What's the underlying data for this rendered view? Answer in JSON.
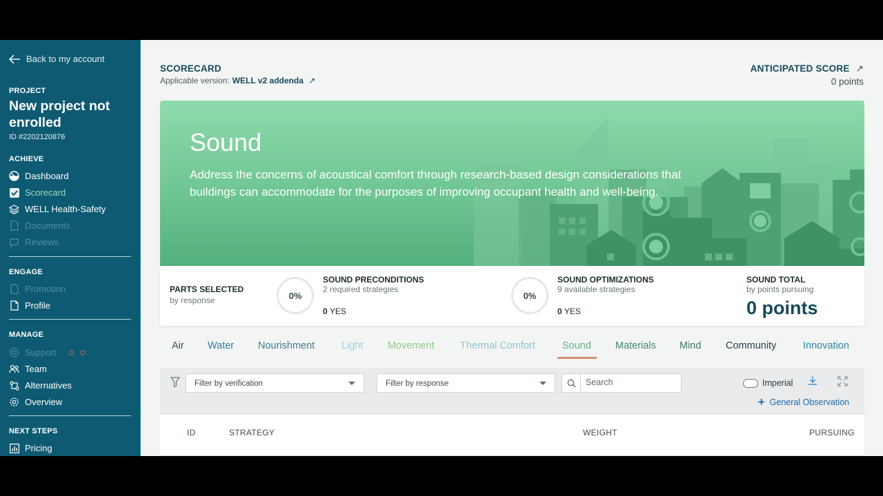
{
  "sidebar": {
    "back_label": "Back to my account",
    "project_section": "PROJECT",
    "project_name": "New project not enrolled",
    "project_id": "ID #2202120876",
    "achieve": {
      "heading": "ACHIEVE",
      "items": [
        {
          "label": "Dashboard",
          "icon": "dashboard-gauge-icon"
        },
        {
          "label": "Scorecard",
          "icon": "checkbox-checked-icon"
        },
        {
          "label": "WELL Health-Safety",
          "icon": "layers-icon"
        },
        {
          "label": "Documents",
          "icon": "document-icon"
        },
        {
          "label": "Reviews",
          "icon": "reviews-icon"
        }
      ]
    },
    "engage": {
      "heading": "ENGAGE",
      "items": [
        {
          "label": "Promotion",
          "icon": "promotion-icon"
        },
        {
          "label": "Profile",
          "icon": "document-icon"
        }
      ]
    },
    "manage": {
      "heading": "MANAGE",
      "items": [
        {
          "label": "Support",
          "icon": "lifebuoy-icon"
        },
        {
          "label": "Team",
          "icon": "team-icon"
        },
        {
          "label": "Alternatives",
          "icon": "alternatives-icon"
        },
        {
          "label": "Overview",
          "icon": "gear-icon"
        }
      ]
    },
    "next_steps": {
      "heading": "NEXT STEPS",
      "items": [
        {
          "label": "Pricing",
          "icon": "pricing-chart-icon"
        }
      ]
    }
  },
  "header": {
    "title": "SCORECARD",
    "version_label": "Applicable version:",
    "version_value": "WELL v2 addenda",
    "anticipated_title": "ANTICIPATED SCORE",
    "anticipated_points": "0 points"
  },
  "banner": {
    "title": "Sound",
    "description": "Address the concerns of acoustical comfort through research-based design considerations that buildings can accommodate for the purposes of improving occupant health and well-being."
  },
  "stats": {
    "parts_selected": {
      "heading": "PARTS SELECTED",
      "sub": "by response"
    },
    "preconditions": {
      "percent": "0%",
      "heading": "SOUND PRECONDITIONS",
      "sub": "2 required strategies",
      "yes_count": "0",
      "yes_label": "YES"
    },
    "optimizations": {
      "percent": "0%",
      "heading": "SOUND OPTIMIZATIONS",
      "sub": "9 available strategies",
      "yes_count": "0",
      "yes_label": "YES"
    },
    "total": {
      "heading": "SOUND TOTAL",
      "sub": "by points pursuing",
      "value": "0 points"
    }
  },
  "tabs": [
    {
      "label": "Air",
      "color": "#2b5568"
    },
    {
      "label": "Water",
      "color": "#2f7ea3"
    },
    {
      "label": "Nourishment",
      "color": "#3d7d93"
    },
    {
      "label": "Light",
      "color": "#9fcde0"
    },
    {
      "label": "Movement",
      "color": "#8fcb8a"
    },
    {
      "label": "Thermal Comfort",
      "color": "#8fc6d2"
    },
    {
      "label": "Sound",
      "color": "#5fb886",
      "active": true
    },
    {
      "label": "Materials",
      "color": "#3f8b67"
    },
    {
      "label": "Mind",
      "color": "#3f7a5e"
    },
    {
      "label": "Community",
      "color": "#24414c"
    },
    {
      "label": "Innovation",
      "color": "#2d89a3"
    }
  ],
  "filters": {
    "verification_placeholder": "Filter by verification",
    "response_placeholder": "Filter by response",
    "search_placeholder": "Search",
    "units_label": "Imperial",
    "general_observation": "General Observation"
  },
  "table": {
    "columns": [
      "ID",
      "STRATEGY",
      "WEIGHT",
      "PURSUING"
    ]
  }
}
